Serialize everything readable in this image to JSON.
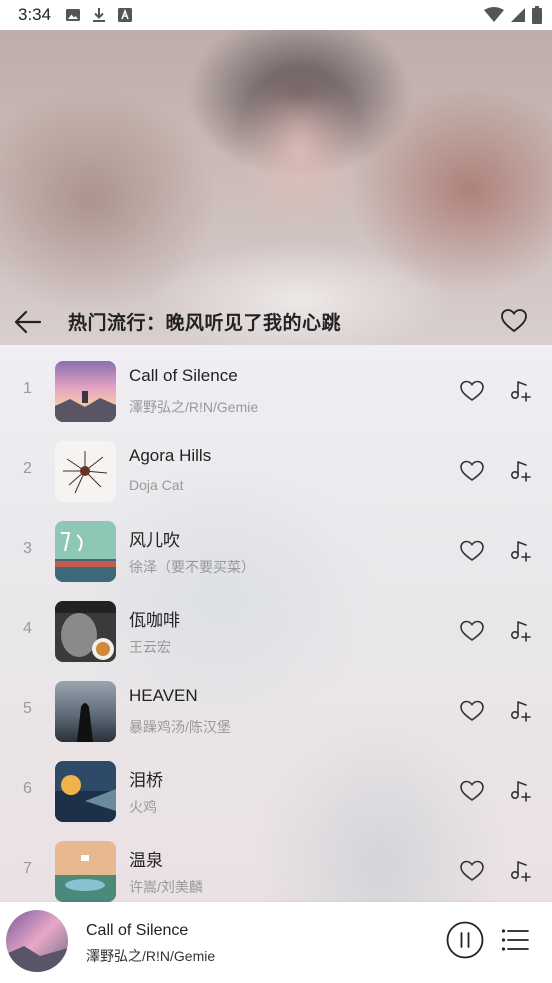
{
  "status_bar": {
    "time": "3:34",
    "left_icons": [
      "image-icon",
      "download-icon",
      "text-a-icon"
    ],
    "right_icons": [
      "wifi-icon",
      "signal-icon",
      "battery-icon"
    ]
  },
  "header": {
    "title": "热门流行：晚风听见了我的心跳"
  },
  "songs": [
    {
      "index": "1",
      "title": "Call of Silence",
      "artist": "澤野弘之/R!N/Gemie"
    },
    {
      "index": "2",
      "title": "Agora Hills",
      "artist": "Doja Cat"
    },
    {
      "index": "3",
      "title": "风儿吹",
      "artist": "徐泽（要不要买菜）"
    },
    {
      "index": "4",
      "title": "佤咖啡",
      "artist": "王云宏"
    },
    {
      "index": "5",
      "title": "HEAVEN",
      "artist": "暴躁鸡汤/陈汉堡"
    },
    {
      "index": "6",
      "title": "泪桥",
      "artist": "火鸡"
    },
    {
      "index": "7",
      "title": "温泉",
      "artist": "许嵩/刘美麟"
    }
  ],
  "player": {
    "title": "Call of Silence",
    "artist": "澤野弘之/R!N/Gemie"
  },
  "colors": {
    "text_primary": "#222222",
    "text_secondary": "#999999",
    "icon": "#333333"
  }
}
